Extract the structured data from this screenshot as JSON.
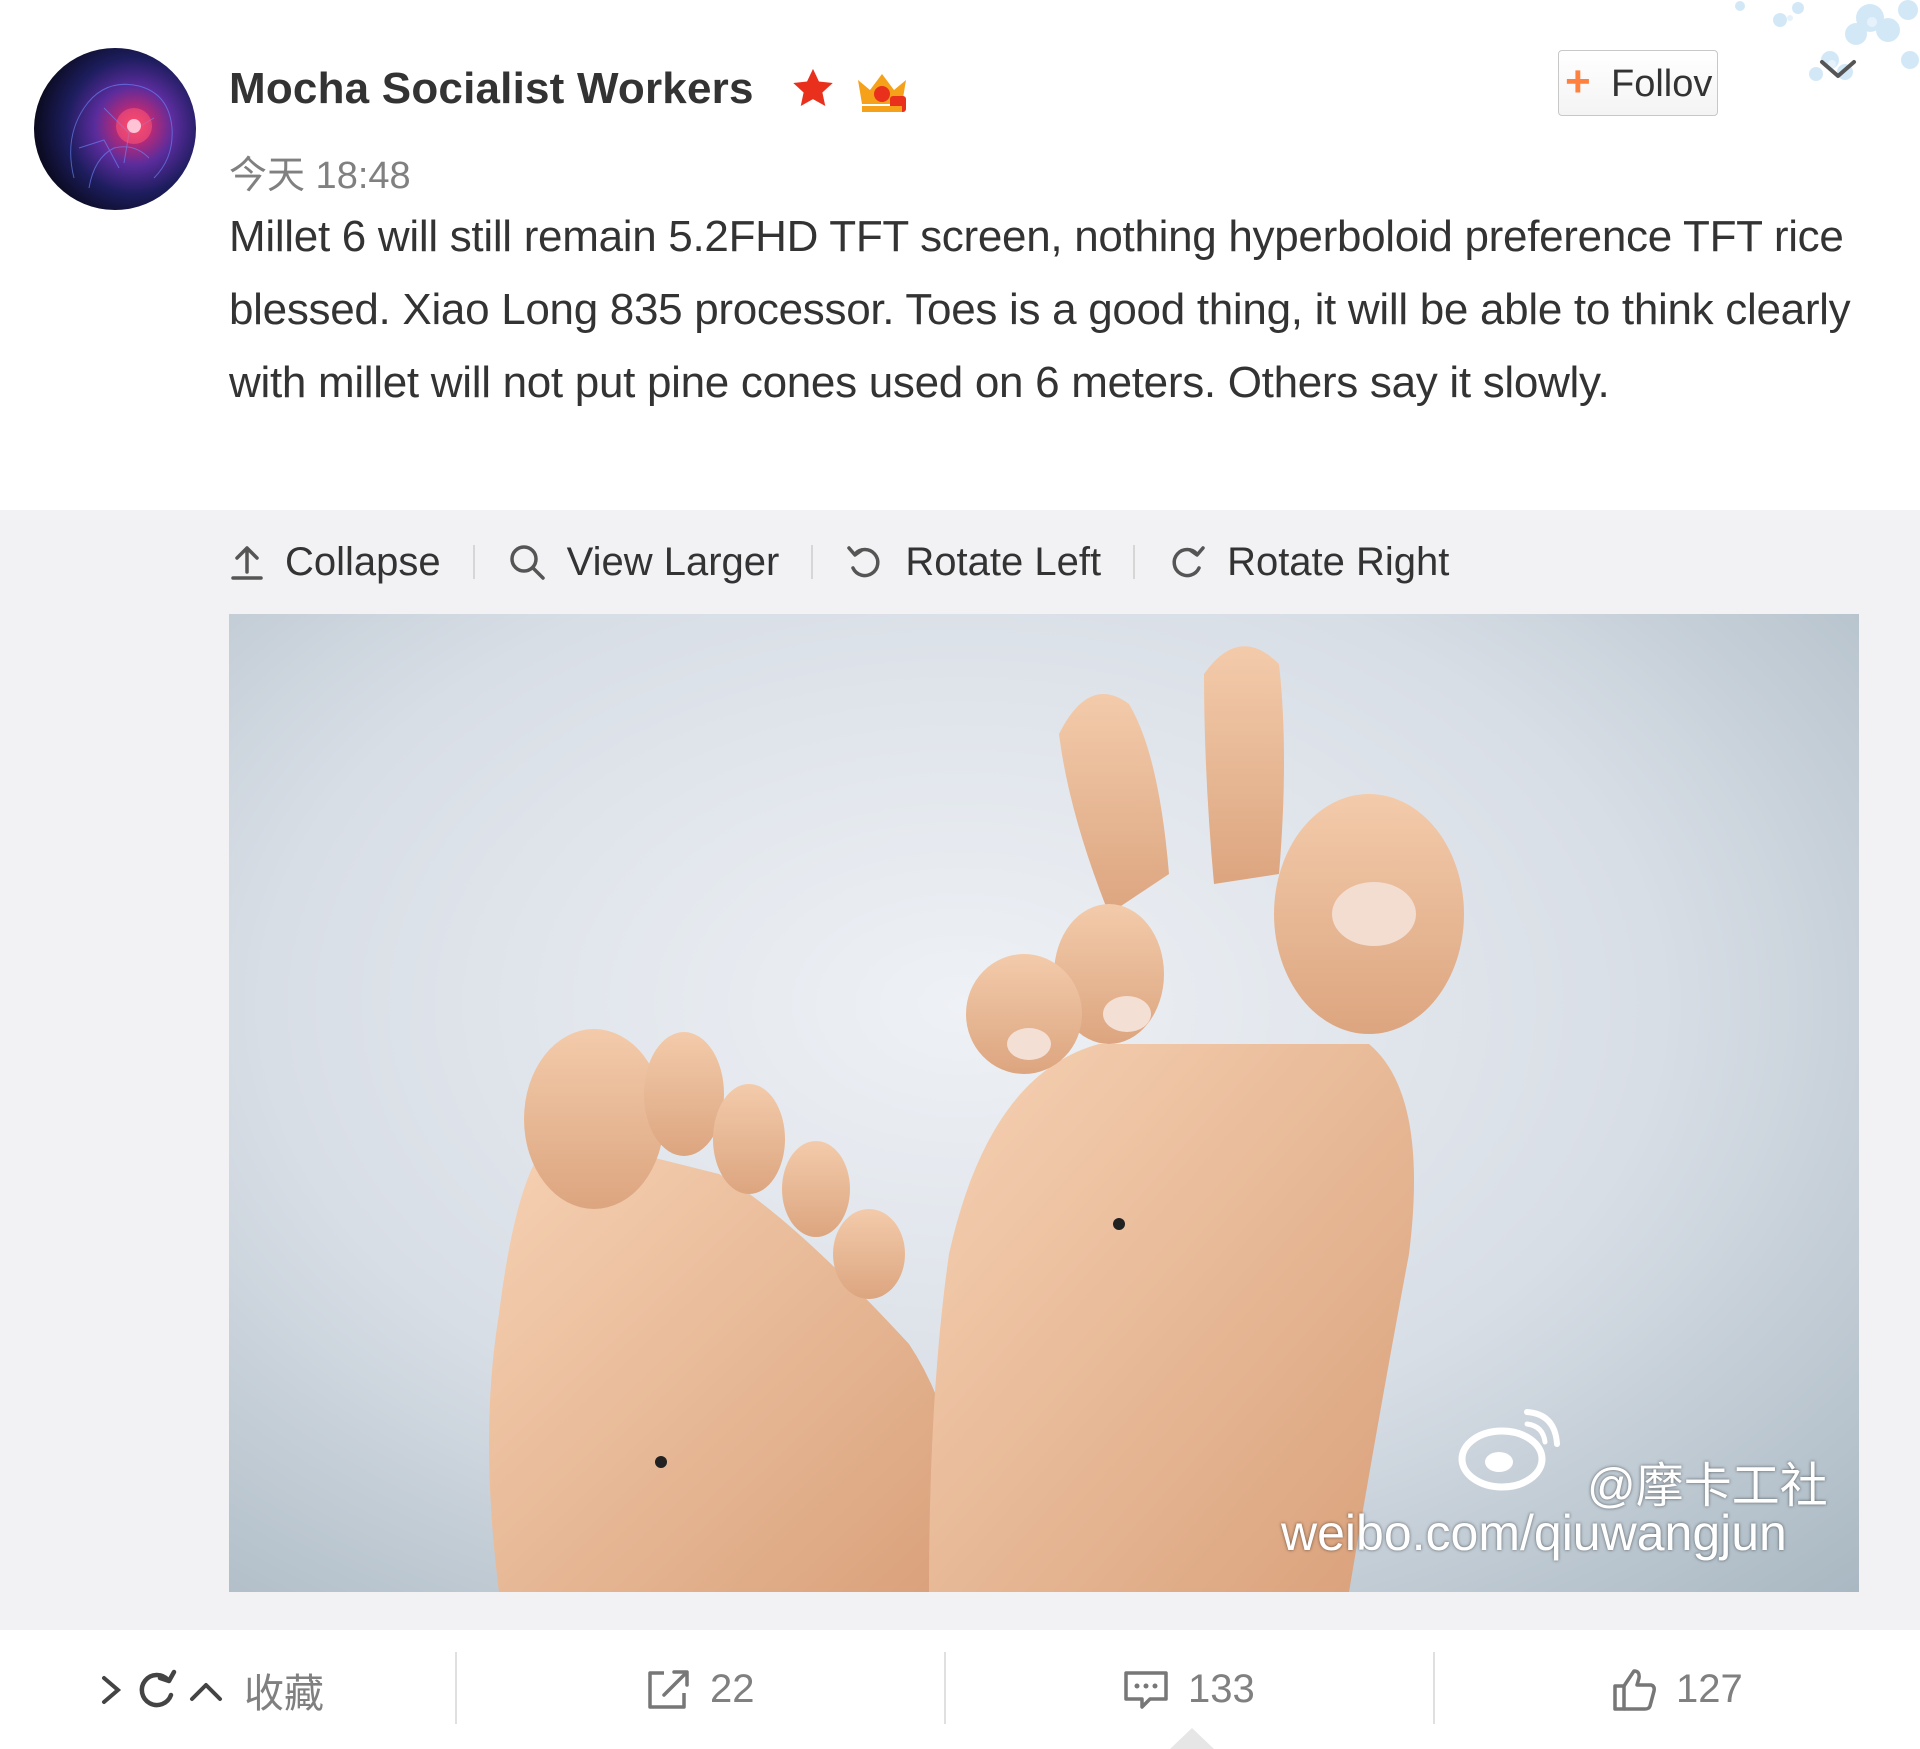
{
  "post": {
    "author": "Mocha Socialist Workers",
    "timestamp": "今天 18:48",
    "text": "Millet 6 will still remain 5.2FHD TFT screen, nothing hyperboloid preference TFT rice blessed. Xiao Long 835 processor. Toes is a good thing, it will be able to think clearly with millet will not put pine cones used on 6 meters. Others say it slowly.",
    "follow_label": "Follov",
    "badges": [
      "star-icon",
      "vip-crown-icon"
    ]
  },
  "media_toolbar": {
    "collapse": "Collapse",
    "view_larger": "View Larger",
    "rotate_left": "Rotate Left",
    "rotate_right": "Rotate Right"
  },
  "photo": {
    "watermark_handle": "@摩卡工社",
    "watermark_url": "weibo.com/qiuwangjun"
  },
  "actions": {
    "favorite": "收藏",
    "repost_count": "22",
    "comment_count": "133",
    "like_count": "127"
  },
  "colors": {
    "accent_orange": "#ff8140",
    "star_red": "#e8301c",
    "panel_bg": "#f2f2f5",
    "text_gray": "#808080"
  }
}
